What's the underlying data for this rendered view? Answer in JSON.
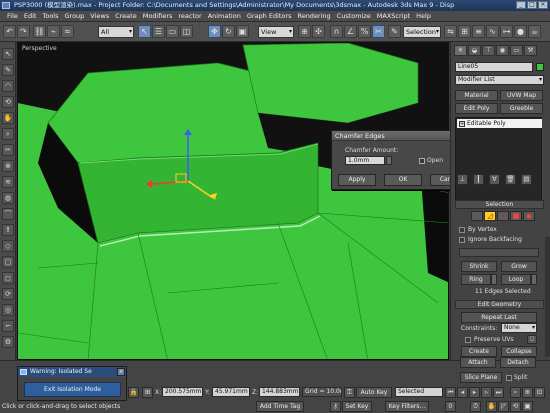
{
  "window": {
    "title": "PSP3000 (模型渲染).max  - Project Folder: C:\\Documents and Settings\\Administrator\\My Documents\\3dsmax  - Autodesk 3ds Max 9  - Disp"
  },
  "menu": [
    "File",
    "Edit",
    "Tools",
    "Group",
    "Views",
    "Create",
    "Modifiers",
    "reactor",
    "Animation",
    "Graph Editors",
    "Rendering",
    "Customize",
    "MAXScript",
    "Help"
  ],
  "toolbar": {
    "filter_value": "All",
    "coord_value": "View",
    "selection_set": "Selection"
  },
  "viewport": {
    "label": "Perspective",
    "mesh_color": "#3ec63e",
    "dark_color": "#0b0b0b"
  },
  "chamfer_dialog": {
    "title": "Chamfer Edges",
    "amount_label": "Chamfer Amount:",
    "amount_value": "1.0mm",
    "open_label": "Open",
    "apply": "Apply",
    "ok": "OK",
    "cancel": "Cancel"
  },
  "command_panel": {
    "object_name": "Line05",
    "modifier_list": "Modifier List",
    "buttons_row1": [
      "Material",
      "UVW Map"
    ],
    "buttons_row2": [
      "Edit Poly",
      "Greeble"
    ],
    "stack_item": "Editable Poly",
    "selection": {
      "header": "Selection",
      "by_vertex": "By Vertex",
      "ignore_backfacing": "Ignore Backfacing",
      "shrink": "Shrink",
      "grow": "Grow",
      "ring": "Ring",
      "loop": "Loop",
      "status": "11 Edges Selected"
    },
    "edit_geometry": {
      "header": "Edit Geometry",
      "repeat_last": "Repeat Last",
      "constraints_label": "Constraints:",
      "constraints_value": "None",
      "preserve_uvs": "Preserve UVs",
      "create": "Create",
      "collapse": "Collapse",
      "attach": "Attach",
      "detach": "Detach",
      "slice_plane": "Slice Plane",
      "split": "Split"
    }
  },
  "warning": {
    "title": "Warning: Isolated Se",
    "exit_button": "Exit Isolation Mode"
  },
  "statusbar": {
    "x_label": "X:",
    "x_value": "200.575mm",
    "y_label": "Y:",
    "y_value": "45.971mm",
    "z_label": "Z:",
    "z_value": "144.883mm",
    "grid": "Grid = 10.0mm",
    "add_time_tag": "Add Time Tag",
    "auto_key": "Auto Key",
    "set_key": "Set Key",
    "key_selected": "Selected",
    "key_filters": "Key Filters...",
    "prompt": "Click or click-and-drag to select objects"
  }
}
